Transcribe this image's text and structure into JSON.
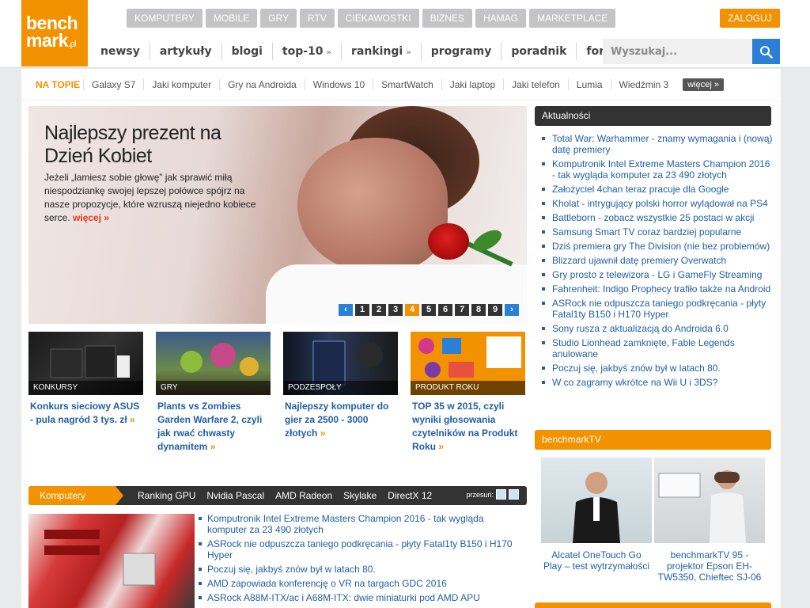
{
  "logo": {
    "line1": "bench",
    "line2": "mark",
    "tld": ".pl"
  },
  "topnav": [
    "KOMPUTERY",
    "MOBILE",
    "GRY",
    "RTV",
    "CIEKAWOSTKI",
    "BIZNES",
    "HAMAG",
    "MARKETPLACE"
  ],
  "login_label": "ZALOGUJ",
  "mainnav": [
    {
      "label": "newsy",
      "dropdown": false
    },
    {
      "label": "artykuły",
      "dropdown": false
    },
    {
      "label": "blogi",
      "dropdown": false
    },
    {
      "label": "top-10",
      "dropdown": true
    },
    {
      "label": "rankingi",
      "dropdown": true
    },
    {
      "label": "programy",
      "dropdown": false
    },
    {
      "label": "poradnik",
      "dropdown": false
    },
    {
      "label": "forum",
      "dropdown": false
    }
  ],
  "search": {
    "placeholder": "Wyszukaj..."
  },
  "trending": {
    "label": "NA TOPIE",
    "items": [
      "Galaxy S7",
      "Jaki komputer",
      "Gry na Androida",
      "Windows 10",
      "SmartWatch",
      "Jaki laptop",
      "Jaki telefon",
      "Lumia",
      "Wiedźmin 3"
    ],
    "more_label": "więcej"
  },
  "hero": {
    "title": "Najlepszy prezent na Dzień Kobiet",
    "text": "Jeżeli „lamiesz sobie głowę” jak sprawić miłą niespodziankę swojej lepszej połówce spójrz na nasze propozycje, które wzruszą niejedno kobiece serce.",
    "more": "więcej »",
    "pages": [
      "1",
      "2",
      "3",
      "4",
      "5",
      "6",
      "7",
      "8",
      "9"
    ],
    "active_page": "4",
    "prev": "‹",
    "next": "›"
  },
  "tiles": [
    {
      "category": "KONKURSY",
      "caption": "Konkurs sieciowy ASUS - pula nagród 3 tys. zł"
    },
    {
      "category": "GRY",
      "caption": "Plants vs Zombies Garden Warfare 2, czyli jak rwać chwasty dynamitem"
    },
    {
      "category": "PODZESPOŁY",
      "caption": "Najlepszy komputer do gier za 2500 - 3000 złotych"
    },
    {
      "category": "PRODUKT ROKU",
      "caption": "TOP 35 w 2015, czyli wyniki głosowania czytelników na Produkt Roku"
    }
  ],
  "tile_arrow": "»",
  "section": {
    "label": "Komputery",
    "links": [
      "Ranking GPU",
      "Nvidia Pascal",
      "AMD Radeon",
      "Skylake",
      "DirectX 12"
    ],
    "scroll_label": "przesuń:"
  },
  "computers_list": [
    "Komputronik Intel Extreme Masters Champion 2016 - tak wygląda komputer za 23 490 złotych",
    "ASRock nie odpuszcza taniego podkręcania - płyty Fatal1ty B150 i H170 Hyper",
    "Poczuj się, jakbyś znów był w latach 80.",
    "AMD zapowiada konferencję o VR na targach GDC 2016",
    "ASRock A88M-ITX/ac i A68M-ITX: dwie miniaturki pod AMD APU"
  ],
  "news": {
    "title": "Aktualności",
    "items": [
      "Total War: Warhammer - znamy wymagania i (nową) datę premiery",
      "Komputronik Intel Extreme Masters Champion 2016 - tak wygląda komputer za 23 490 złotych",
      "Założyciel 4chan teraz pracuje dla Google",
      "Kholat - intrygujący polski horror wylądował na PS4",
      "Battleborn - zobacz wszystkie 25 postaci w akcji",
      "Samsung Smart TV coraz bardziej popularne",
      "Dziś premiera gry The Division (nie bez problemów)",
      "Blizzard ujawnił datę premiery Overwatch",
      "Gry prosto z telewizora - LG i GameFly Streaming",
      "Fahrenheit: Indigo Prophecy trafiło także na Android",
      "ASRock nie odpuszcza taniego podkręcania - płyty Fatal1ty B150 i H170 Hyper",
      "Sony rusza z aktualizacją do Androida 6.0",
      "Studio Lionhead zamknięte, Fable Legends anulowane",
      "Poczuj się, jakbyś znów był w latach 80.",
      "W co zagramy wkrótce na Wii U i 3DS?"
    ]
  },
  "tv": {
    "title": "benchmarkTV",
    "videos": [
      "Alcatel OneTouch Go Play – test wytrzymałości",
      "benchmarkTV 95 - projektor Epson EH-TW5350, Chieftec SJ-06"
    ]
  },
  "colors": {
    "accent": "#f39200",
    "link": "#1f5fa5",
    "dark": "#333333",
    "search_button": "#2a80d6"
  }
}
